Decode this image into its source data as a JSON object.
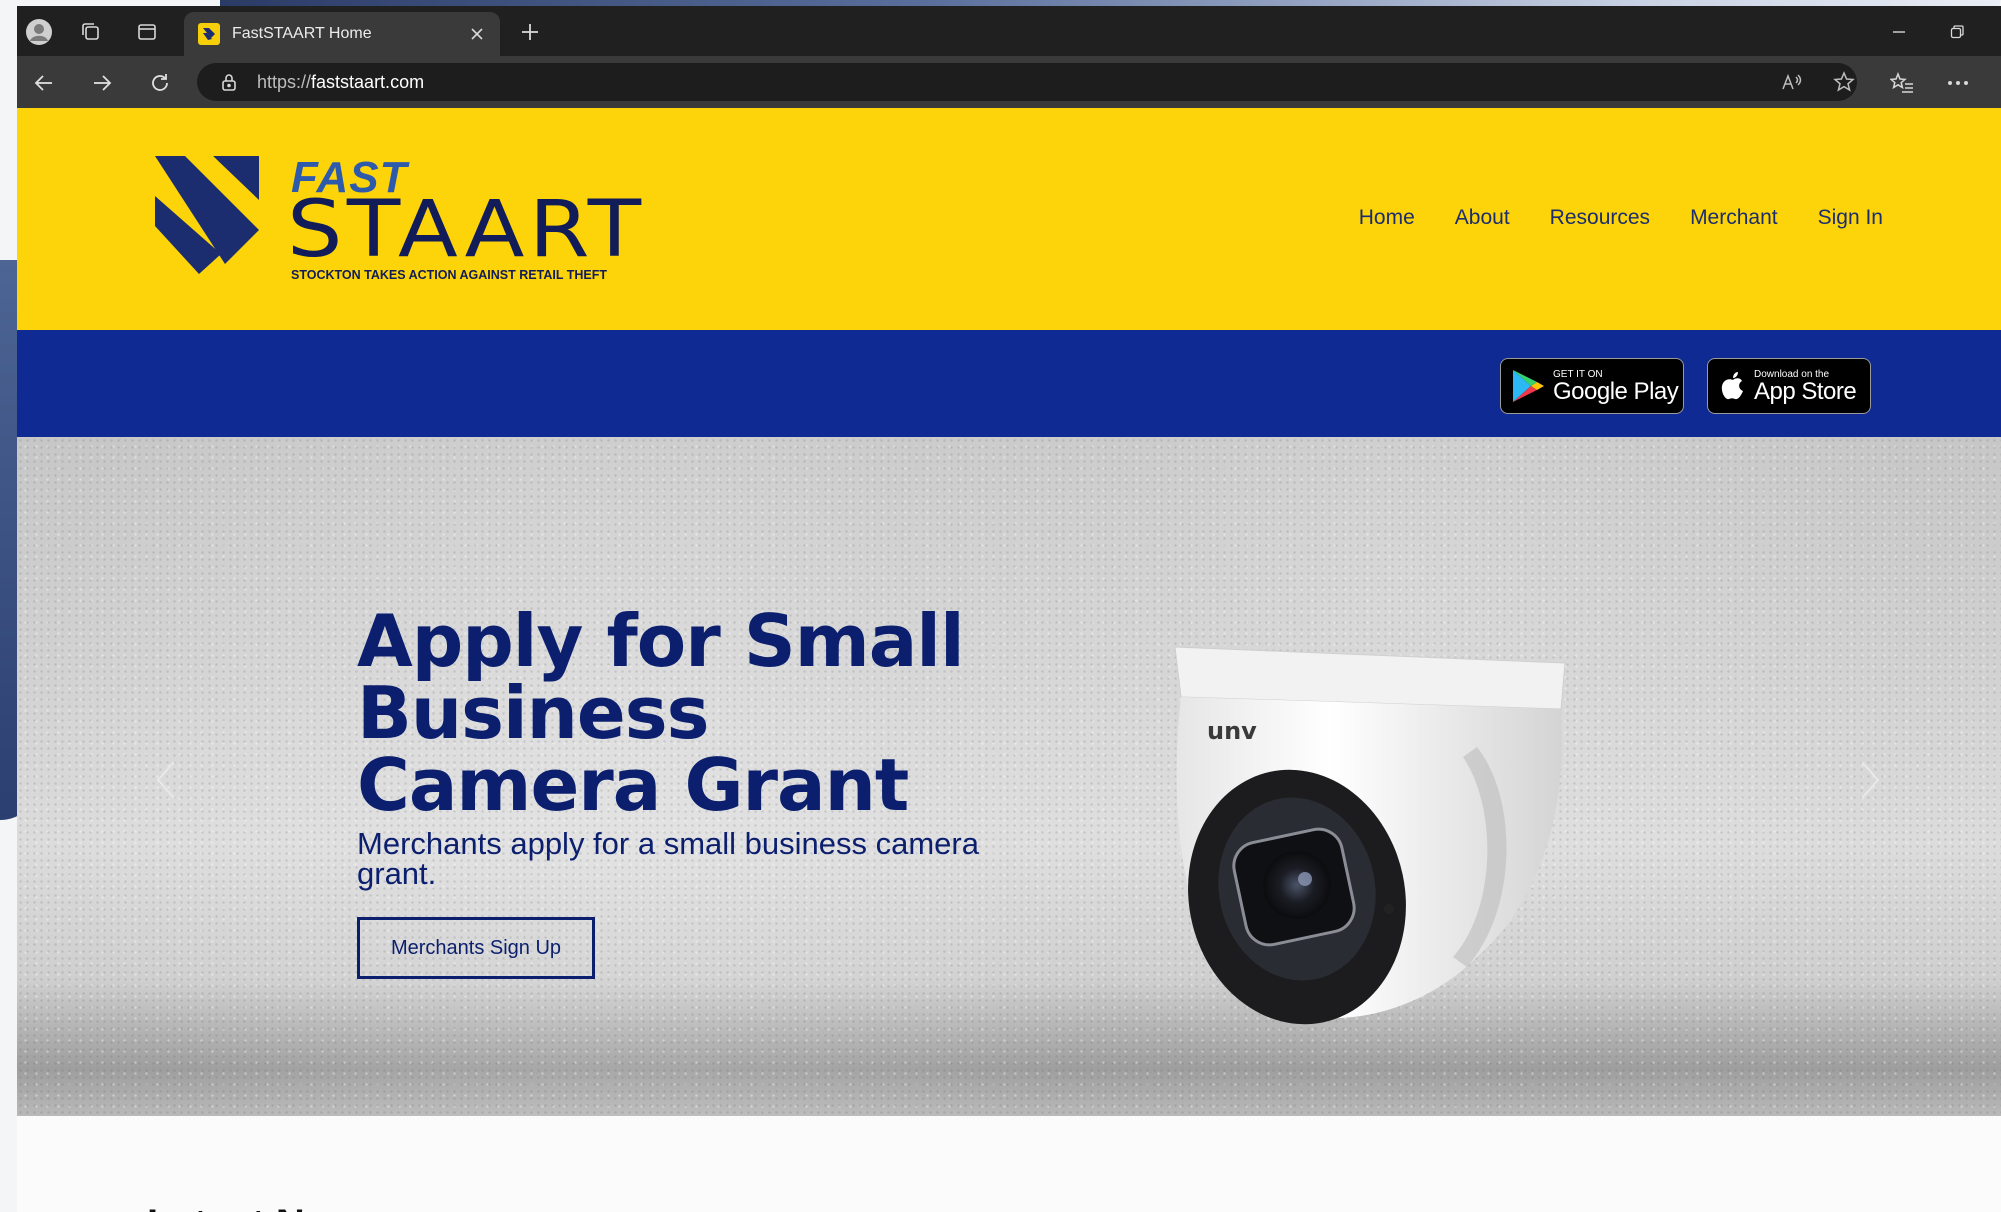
{
  "browser": {
    "tab_title": "FastSTAART Home",
    "url_scheme": "https://",
    "url_host": "faststaart.com"
  },
  "site": {
    "logo": {
      "fast": "FAST",
      "staart": "STAART",
      "tagline": "STOCKTON TAKES ACTION AGAINST RETAIL THEFT"
    },
    "nav": [
      {
        "label": "Home"
      },
      {
        "label": "About"
      },
      {
        "label": "Resources"
      },
      {
        "label": "Merchant"
      },
      {
        "label": "Sign In"
      }
    ],
    "stores": {
      "google_small": "GET IT ON",
      "google_big": "Google Play",
      "apple_small": "Download on the",
      "apple_big": "App Store"
    },
    "hero": {
      "title": "Apply for Small Business Camera Grant",
      "subtitle": "Merchants apply for a small business camera grant.",
      "cta": "Merchants Sign Up",
      "camera_brand": "unv"
    },
    "section_heading_partial": "Latest N"
  },
  "colors": {
    "header_yellow": "#fdd409",
    "band_blue": "#0f2a93",
    "text_navy": "#0b1f6e"
  }
}
